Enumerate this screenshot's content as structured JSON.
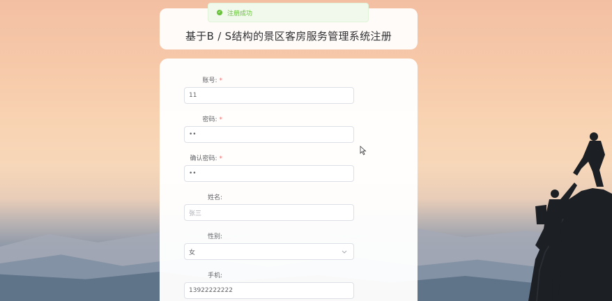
{
  "toast": {
    "message": "注册成功",
    "icon": "check-circle-icon"
  },
  "title": "基于B / S结构的景区客房服务管理系统注册",
  "fields": [
    {
      "label": "账号:",
      "required": true,
      "value": "11"
    },
    {
      "label": "密码:",
      "required": true,
      "value": "••"
    },
    {
      "label": "确认密码:",
      "required": true,
      "value": "••"
    },
    {
      "label": "姓名:",
      "required": false,
      "value": "张三"
    },
    {
      "label": "性别:",
      "required": false,
      "value": "女"
    },
    {
      "label": "手机:",
      "required": false,
      "value": "13922222222"
    }
  ],
  "colors": {
    "success": "#67c23a",
    "required": "#f56c6c",
    "border": "#dcdfe6"
  }
}
